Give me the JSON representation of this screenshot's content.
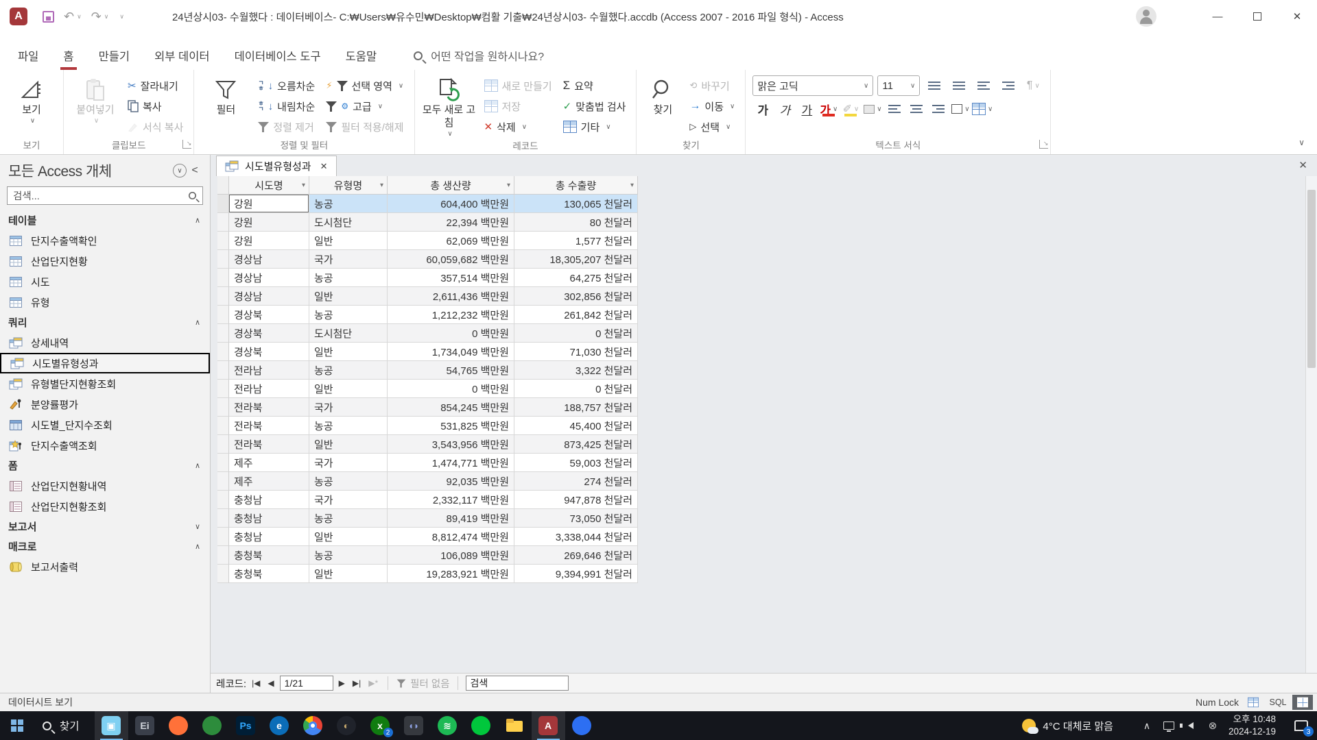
{
  "title_bar": {
    "title": "24년상시03- 수월했다 : 데이터베이스- C:₩Users₩유수민₩Desktop₩컴활 기출₩24년상시03- 수월했다.accdb (Access 2007 - 2016 파일 형식)  -  Access",
    "app_letter": "A"
  },
  "ribbon_tabs": [
    {
      "label": "파일",
      "active": false
    },
    {
      "label": "홈",
      "active": true
    },
    {
      "label": "만들기",
      "active": false
    },
    {
      "label": "외부 데이터",
      "active": false
    },
    {
      "label": "데이터베이스 도구",
      "active": false
    },
    {
      "label": "도움말",
      "active": false
    }
  ],
  "ribbon_search": {
    "placeholder": "어떤 작업을 원하시나요?"
  },
  "ribbon": {
    "views": {
      "label": "보기",
      "view": "보기"
    },
    "clipboard": {
      "label": "클립보드",
      "paste": "붙여넣기",
      "cut": "잘라내기",
      "copy": "복사",
      "format_painter": "서식 복사"
    },
    "sort_filter": {
      "label": "정렬 및 필터",
      "filter": "필터",
      "ascending": "오름차순",
      "descending": "내림차순",
      "remove_sort": "정렬 제거",
      "selection": "선택 영역",
      "advanced": "고급",
      "toggle_filter": "필터 적용/해제"
    },
    "records": {
      "label": "레코드",
      "refresh_all": "모두 새로 고침",
      "new": "새로 만들기",
      "save": "저장",
      "delete": "삭제",
      "totals": "요약",
      "spelling": "맞춤법 검사",
      "more": "기타"
    },
    "find": {
      "label": "찾기",
      "find": "찾기",
      "replace": "바꾸기",
      "go_to": "이동",
      "select": "선택"
    },
    "text_formatting": {
      "label": "텍스트 서식",
      "font_name": "맑은 고딕",
      "font_size": "11"
    }
  },
  "icons": {
    "sigma": "Σ",
    "check": "✓",
    "arrow_right": "→",
    "x_red": "✕",
    "scissors": "✂",
    "undo": "↶",
    "redo": "↷",
    "chevron_down": "∨",
    "chevron_up": "∧",
    "cursor": "▷",
    "bold": "가",
    "italic": "가",
    "underline": "가",
    "font_color": "가",
    "sort_top": "ㄱ",
    "sort_bottom": "ㅎ",
    "down_arrow": "↓",
    "replace": "바꾸기"
  },
  "nav_pane": {
    "title": "모든 Access 개체",
    "search_placeholder": "검색...",
    "sections": [
      {
        "label": "테이블",
        "collapsed": false,
        "items": [
          {
            "label": "단지수출액확인",
            "icon": "table"
          },
          {
            "label": "산업단지현황",
            "icon": "table"
          },
          {
            "label": "시도",
            "icon": "table"
          },
          {
            "label": "유형",
            "icon": "table"
          }
        ]
      },
      {
        "label": "쿼리",
        "collapsed": false,
        "items": [
          {
            "label": "상세내역",
            "icon": "query"
          },
          {
            "label": "시도별유형성과",
            "icon": "query",
            "selected": true
          },
          {
            "label": "유형별단지현황조회",
            "icon": "query"
          },
          {
            "label": "분양률평가",
            "icon": "query-action"
          },
          {
            "label": "시도별_단지수조회",
            "icon": "table-special"
          },
          {
            "label": "단지수출액조회",
            "icon": "query-param"
          }
        ]
      },
      {
        "label": "폼",
        "collapsed": false,
        "items": [
          {
            "label": "산업단지현황내역",
            "icon": "form"
          },
          {
            "label": "산업단지현황조회",
            "icon": "form"
          }
        ]
      },
      {
        "label": "보고서",
        "collapsed": true,
        "items": []
      },
      {
        "label": "매크로",
        "collapsed": false,
        "items": [
          {
            "label": "보고서출력",
            "icon": "macro"
          }
        ]
      }
    ]
  },
  "document": {
    "tab_label": "시도별유형성과"
  },
  "table": {
    "columns": [
      "시도명",
      "유형명",
      "총 생산량",
      "총 수출량"
    ],
    "units": {
      "production": "백만원",
      "export": "천달러"
    },
    "selected_row": 0,
    "rows": [
      [
        "강원",
        "농공",
        "604,400",
        "130,065"
      ],
      [
        "강원",
        "도시첨단",
        "22,394",
        "80"
      ],
      [
        "강원",
        "일반",
        "62,069",
        "1,577"
      ],
      [
        "경상남",
        "국가",
        "60,059,682",
        "18,305,207"
      ],
      [
        "경상남",
        "농공",
        "357,514",
        "64,275"
      ],
      [
        "경상남",
        "일반",
        "2,611,436",
        "302,856"
      ],
      [
        "경상북",
        "농공",
        "1,212,232",
        "261,842"
      ],
      [
        "경상북",
        "도시첨단",
        "0",
        "0"
      ],
      [
        "경상북",
        "일반",
        "1,734,049",
        "71,030"
      ],
      [
        "전라남",
        "농공",
        "54,765",
        "3,322"
      ],
      [
        "전라남",
        "일반",
        "0",
        "0"
      ],
      [
        "전라북",
        "국가",
        "854,245",
        "188,757"
      ],
      [
        "전라북",
        "농공",
        "531,825",
        "45,400"
      ],
      [
        "전라북",
        "일반",
        "3,543,956",
        "873,425"
      ],
      [
        "제주",
        "국가",
        "1,474,771",
        "59,003"
      ],
      [
        "제주",
        "농공",
        "92,035",
        "274"
      ],
      [
        "충청남",
        "국가",
        "2,332,117",
        "947,878"
      ],
      [
        "충청남",
        "농공",
        "89,419",
        "73,050"
      ],
      [
        "충청남",
        "일반",
        "8,812,474",
        "3,338,044"
      ],
      [
        "충청북",
        "농공",
        "106,089",
        "269,646"
      ],
      [
        "충청북",
        "일반",
        "19,283,921",
        "9,394,991"
      ]
    ]
  },
  "record_nav": {
    "label": "레코드:",
    "position": "1/21",
    "no_filter": "필터 없음",
    "search_placeholder": "검색"
  },
  "status_bar": {
    "view_mode": "데이터시트 보기",
    "num_lock": "Num Lock",
    "sql": "SQL"
  },
  "taskbar": {
    "search_label": "찾기",
    "weather_text": "4°C 대체로 맑음",
    "time": "오후 10:48",
    "date": "2024-12-19",
    "notification_count": "3",
    "apps": [
      {
        "name": "media-app",
        "shape": "square",
        "bg": "#7fd0f2",
        "fg": "#ffffff",
        "glyph": "▣",
        "active": true
      },
      {
        "name": "utility-app",
        "shape": "square",
        "bg": "#3a3f4a",
        "fg": "#cfd3da",
        "glyph": "Ei",
        "active": false
      },
      {
        "name": "firefox-browser",
        "shape": "circle",
        "bg": "#ff7139",
        "fg": "#ffffff",
        "glyph": "",
        "active": false
      },
      {
        "name": "messenger-app",
        "shape": "circle",
        "bg": "#2d8c3c",
        "fg": "#ffffff",
        "glyph": "",
        "active": false
      },
      {
        "name": "photoshop",
        "shape": "square",
        "bg": "#001e36",
        "fg": "#31a8ff",
        "glyph": "Ps",
        "active": false
      },
      {
        "name": "mail-app",
        "shape": "circle",
        "bg": "#0b6db8",
        "fg": "#ffffff",
        "glyph": "e",
        "active": false
      },
      {
        "name": "chrome-browser",
        "shape": "chrome",
        "bg": "",
        "fg": "",
        "glyph": "",
        "active": false
      },
      {
        "name": "game-launcher",
        "shape": "circle",
        "bg": "#20232b",
        "fg": "#c8aa6e",
        "glyph": "◐",
        "active": false
      },
      {
        "name": "xbox-app",
        "shape": "circle",
        "bg": "#107c10",
        "fg": "#ffffff",
        "glyph": "x",
        "badge": "2",
        "active": false
      },
      {
        "name": "discord",
        "shape": "square",
        "bg": "#36393f",
        "fg": "#8ea1e1",
        "glyph": "◖◗",
        "active": false
      },
      {
        "name": "spotify",
        "shape": "circle",
        "bg": "#1db954",
        "fg": "#ffffff",
        "glyph": "≋",
        "active": false
      },
      {
        "name": "green-app",
        "shape": "circle",
        "bg": "#00c73c",
        "fg": "#ffffff",
        "glyph": "",
        "active": false
      },
      {
        "name": "file-explorer",
        "shape": "folder",
        "bg": "",
        "fg": "",
        "glyph": "",
        "active": false
      },
      {
        "name": "access",
        "shape": "square",
        "bg": "#a4373a",
        "fg": "#ffffff",
        "glyph": "A",
        "active": true
      },
      {
        "name": "whale-browser",
        "shape": "circle",
        "bg": "#2d6ff2",
        "fg": "#ffffff",
        "glyph": "",
        "active": false
      }
    ]
  }
}
